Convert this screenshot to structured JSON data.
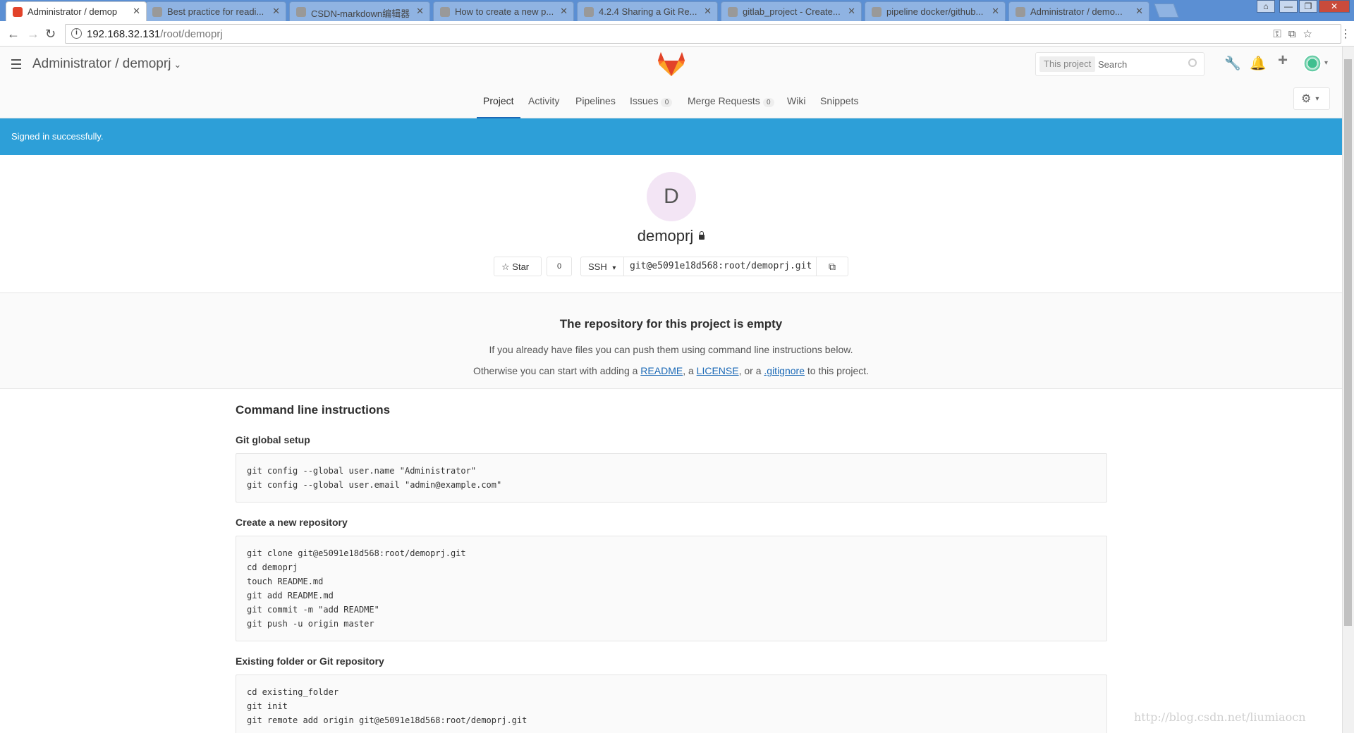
{
  "browser": {
    "tabs": [
      {
        "title": "Administrator / demop",
        "active": true
      },
      {
        "title": "Best practice for readi...",
        "active": false
      },
      {
        "title": "CSDN-markdown编辑器",
        "active": false
      },
      {
        "title": "How to create a new p...",
        "active": false
      },
      {
        "title": "4.2.4 Sharing a Git Re...",
        "active": false
      },
      {
        "title": "gitlab_project - Create...",
        "active": false
      },
      {
        "title": "pipeline docker/github...",
        "active": false
      },
      {
        "title": "Administrator / demo...",
        "active": false
      }
    ],
    "close_glyph": "✕",
    "url_host": "192.168.32.131",
    "url_path": "/root/demoprj",
    "window_controls": [
      "⌂",
      "—",
      "❐",
      "✕"
    ],
    "icons": [
      "back-arrow-icon",
      "forward-arrow-icon",
      "reload-icon",
      "info-icon",
      "key-icon",
      "translate-icon",
      "star-icon",
      "menu-dots-icon"
    ],
    "icon_glyphs": {
      "back": "←",
      "forward": "→",
      "reload": "↻",
      "info": "i",
      "key": "⚿",
      "translate": "⧉",
      "star": "☆",
      "menu": "⋮"
    }
  },
  "header": {
    "namespace": "Administrator",
    "separator": " / ",
    "project": "demoprj",
    "chevron": "⌄",
    "search_scope": "This project",
    "search_placeholder": "Search",
    "icon_glyphs": {
      "admin": "🔧",
      "notifications": "🔔",
      "new": "+",
      "settings": "⚙",
      "caret": "▾"
    }
  },
  "nav": {
    "items": [
      {
        "label": "Project",
        "active": true
      },
      {
        "label": "Activity"
      },
      {
        "label": "Pipelines"
      },
      {
        "label": "Issues",
        "count": "0"
      },
      {
        "label": "Merge Requests",
        "count": "0"
      },
      {
        "label": "Wiki"
      },
      {
        "label": "Snippets"
      }
    ]
  },
  "flash": {
    "message": "Signed in successfully."
  },
  "project": {
    "avatar_letter": "D",
    "name": "demoprj",
    "star_label": "Star",
    "star_glyph": "☆",
    "star_count": "0",
    "protocol": "SSH",
    "protocol_caret": "▾",
    "clone_url": "git@e5091e18d568:root/demoprj.git",
    "copy_glyph": "⧉"
  },
  "empty_state": {
    "title": "The repository for this project is empty",
    "line1": "If you already have files you can push them using command line instructions below.",
    "line2_prefix": "Otherwise you can start with adding a ",
    "link_readme": "README",
    "sep1": ", a ",
    "link_license": "LICENSE",
    "sep2": ", or a ",
    "link_gitignore": ".gitignore",
    "line2_suffix": " to this project."
  },
  "instructions": {
    "title": "Command line instructions",
    "sections": [
      {
        "heading": "Git global setup",
        "code": "git config --global user.name \"Administrator\"\ngit config --global user.email \"admin@example.com\""
      },
      {
        "heading": "Create a new repository",
        "code": "git clone git@e5091e18d568:root/demoprj.git\ncd demoprj\ntouch README.md\ngit add README.md\ngit commit -m \"add README\"\ngit push -u origin master"
      },
      {
        "heading": "Existing folder or Git repository",
        "code": "cd existing_folder\ngit init\ngit remote add origin git@e5091e18d568:root/demoprj.git"
      }
    ]
  },
  "watermark": "http://blog.csdn.net/liumiaocn",
  "colors": {
    "brand_blue": "#2d9fd8",
    "link": "#1b69b6",
    "tab_bar": "#5b8fd3"
  }
}
